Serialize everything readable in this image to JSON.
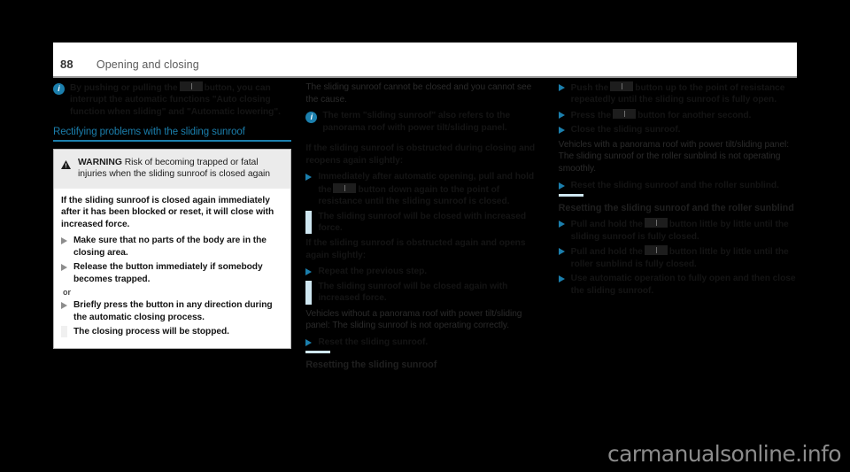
{
  "header": {
    "page_number": "88",
    "title": "Opening and closing"
  },
  "icons": {
    "info": "i",
    "warning": "warning-triangle-icon",
    "button": "rocker-switch-icon"
  },
  "colors": {
    "accent": "#1b7fad",
    "rail": "#cfe7f1",
    "warning_bg": "#ebebeb",
    "page_bg": "#ffffff",
    "screen_bg": "#000000"
  },
  "left_column": {
    "note": {
      "text_before_button": "By pushing or pulling the",
      "text_after_button": "button, you can interrupt the automatic functions \"Auto closing function when sliding\" and \"Automatic lowering\"."
    },
    "section_heading": "Rectifying problems with the sliding sunroof",
    "warning": {
      "label": "WARNING",
      "text": "Risk of becoming trapped or fatal injuries when the sliding sunroof is closed again"
    },
    "warning_body_intro": "If the sliding sunroof is closed again immediately after it has been blocked or reset, it will close with increased force.",
    "warning_bullets": [
      "Make sure that no parts of the body are in the closing area.",
      "Release the button immediately if somebody becomes trapped."
    ],
    "or_label": "or",
    "warning_bullets_alt": [
      "Briefly press the button in any direction during the automatic closing process.",
      "The closing process will be stopped."
    ]
  },
  "middle_column": {
    "problem_intro": "The sliding sunroof cannot be closed and you cannot see the cause.",
    "note": "The term \"sliding sunroof\" also refers to the panorama roof with power tilt/sliding panel.",
    "case1_heading": "If the sliding sunroof is obstructed during closing and reopens again slightly:",
    "case1_step_before_button": "Immediately after automatic opening, pull and hold the",
    "case1_step_after_button": "button down again to the point of resistance until the sliding sunroof is closed.",
    "case1_result": "The sliding sunroof will be closed with increased force.",
    "case2_heading": "If the sliding sunroof is obstructed again and opens again slightly:",
    "case2_step": "Repeat the previous step.",
    "case2_result": "The sliding sunroof will be closed again with increased force.",
    "case3_intro": "Vehicles without a panorama roof with power tilt/sliding panel: The sliding sunroof is not operating correctly.",
    "case3_step": "Reset the sliding sunroof.",
    "faded_heading": "Resetting the sliding sunroof"
  },
  "right_column": {
    "steps_top": [
      {
        "before": "Push the",
        "after": "button up to the point of resistance repeatedly until the sliding sunroof is fully open."
      },
      {
        "before": "Press the",
        "after": "button for another second."
      },
      {
        "before": "",
        "after": "Close the sliding sunroof."
      }
    ],
    "case_intro": "Vehicles with a panorama roof with power tilt/sliding panel: The sliding sunroof or the roller sunblind is not operating smoothly.",
    "case_step": "Reset the sliding sunroof and the roller sunblind.",
    "faded_heading": "Resetting the sliding sunroof and the roller sunblind",
    "steps_bottom": [
      {
        "before": "Pull and hold the",
        "after": "button little by little until the sliding sunroof is fully closed."
      },
      {
        "before": "Pull and hold the",
        "after": "button little by little until the roller sunblind is fully closed."
      },
      {
        "before": "",
        "after": "Use automatic operation to fully open and then close the sliding sunroof."
      }
    ]
  },
  "watermark": "carmanualsonline.info"
}
